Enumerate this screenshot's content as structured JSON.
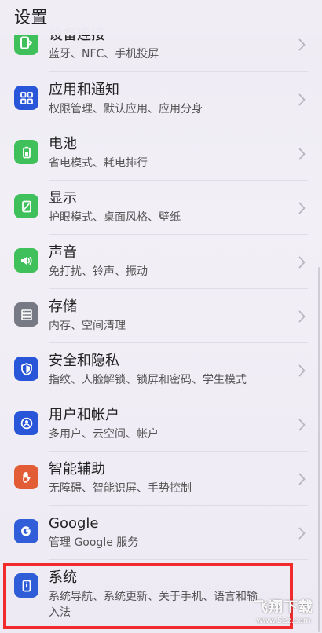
{
  "header": {
    "title": "设置"
  },
  "partial_row": {
    "title": "设备连接",
    "subtitle": "蓝牙、NFC、手机投屏"
  },
  "rows": [
    {
      "title": "应用和通知",
      "subtitle": "权限管理、默认应用、应用分身"
    },
    {
      "title": "电池",
      "subtitle": "省电模式、耗电排行"
    },
    {
      "title": "显示",
      "subtitle": "护眼模式、桌面风格、壁纸"
    },
    {
      "title": "声音",
      "subtitle": "免打扰、铃声、振动"
    },
    {
      "title": "存储",
      "subtitle": "内存、空间清理"
    },
    {
      "title": "安全和隐私",
      "subtitle": "指纹、人脸解锁、锁屏和密码、学生模式"
    },
    {
      "title": "用户和帐户",
      "subtitle": "多用户、云空间、帐户"
    },
    {
      "title": "智能辅助",
      "subtitle": "无障碍、智能识屏、手势控制"
    },
    {
      "title": "Google",
      "subtitle": "管理 Google 服务"
    },
    {
      "title": "系统",
      "subtitle": "系统导航、系统更新、关于手机、语言和输入法"
    }
  ],
  "icons": [
    "device-connection-icon",
    "apps-grid-icon",
    "battery-icon",
    "display-icon",
    "sound-icon",
    "storage-icon",
    "security-shield-icon",
    "user-account-icon",
    "hand-assist-icon",
    "google-icon",
    "system-icon"
  ],
  "watermark": {
    "main": "飞翔下载",
    "sub": "www.52z.com"
  },
  "colors": {
    "highlight": "#ef2b2d",
    "green_icon": "#40c05b",
    "blue_icon": "#2956d9",
    "gray_icon": "#777984",
    "orange_icon": "#e25c35"
  }
}
